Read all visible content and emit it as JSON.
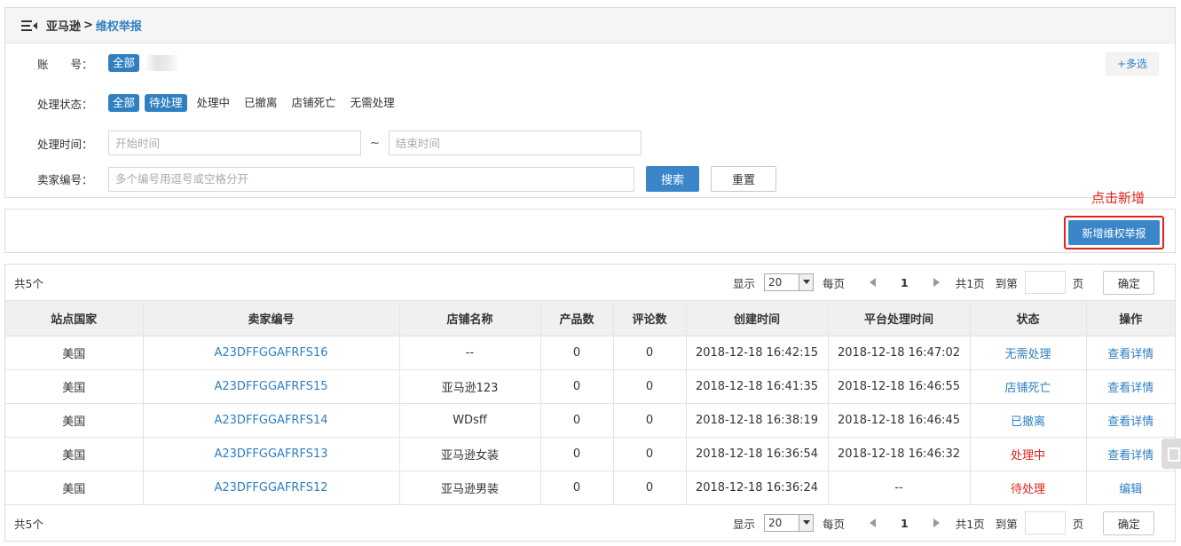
{
  "breadcrumb": {
    "root": "亚马逊",
    "sep": ">",
    "current": "维权举报"
  },
  "filters": {
    "account": {
      "label": "账　　号：",
      "options": [
        "全部"
      ]
    },
    "multi_select": "+多选",
    "status": {
      "label": "处理状态：",
      "options": [
        "全部",
        "待处理",
        "处理中",
        "已撤离",
        "店铺死亡",
        "无需处理"
      ],
      "selected": [
        "全部",
        "待处理"
      ]
    },
    "time": {
      "label": "处理时间：",
      "start_placeholder": "开始时间",
      "end_placeholder": "结束时间",
      "sep": "~"
    },
    "seller": {
      "label": "卖家编号：",
      "placeholder": "多个编号用逗号或空格分开"
    },
    "search_label": "搜索",
    "reset_label": "重置"
  },
  "toolbar": {
    "annotation": "点击新增",
    "add_label": "新增维权举报"
  },
  "pager": {
    "total": "共5个",
    "show": "显示",
    "page_size": "20",
    "per_page": "每页",
    "current_page": "1",
    "total_pages": "共1页",
    "goto": "到第",
    "page_unit": "页",
    "confirm": "确定"
  },
  "table": {
    "headers": [
      "站点国家",
      "卖家编号",
      "店铺名称",
      "产品数",
      "评论数",
      "创建时间",
      "平台处理时间",
      "状态",
      "操作"
    ],
    "rows": [
      {
        "country": "美国",
        "seller": "A23DFFGGAFRFS16",
        "shop": "--",
        "products": "0",
        "reviews": "0",
        "created": "2018-12-18 16:42:15",
        "processed": "2018-12-18 16:47:02",
        "status": "无需处理",
        "action": "查看详情"
      },
      {
        "country": "美国",
        "seller": "A23DFFGGAFRFS15",
        "shop": "亚马逊123",
        "products": "0",
        "reviews": "0",
        "created": "2018-12-18 16:41:35",
        "processed": "2018-12-18 16:46:55",
        "status": "店铺死亡",
        "action": "查看详情"
      },
      {
        "country": "美国",
        "seller": "A23DFFGGAFRFS14",
        "shop": "WDsff",
        "products": "0",
        "reviews": "0",
        "created": "2018-12-18 16:38:19",
        "processed": "2018-12-18 16:46:45",
        "status": "已撤离",
        "action": "查看详情"
      },
      {
        "country": "美国",
        "seller": "A23DFFGGAFRFS13",
        "shop": "亚马逊女装",
        "products": "0",
        "reviews": "0",
        "created": "2018-12-18 16:36:54",
        "processed": "2018-12-18 16:46:32",
        "status": "处理中",
        "action": "查看详情"
      },
      {
        "country": "美国",
        "seller": "A23DFFGGAFRFS12",
        "shop": "亚马逊男装",
        "products": "0",
        "reviews": "0",
        "created": "2018-12-18 16:36:24",
        "processed": "--",
        "status": "待处理",
        "action": "编辑"
      }
    ]
  },
  "colors": {
    "accent": "#2f7fc1",
    "alert": "#e0231b"
  }
}
